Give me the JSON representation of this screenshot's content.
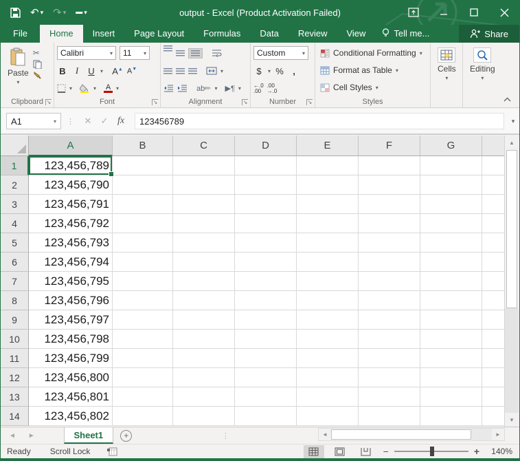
{
  "window": {
    "title": "output - Excel (Product Activation Failed)"
  },
  "tabs": {
    "file": "File",
    "items": [
      "Home",
      "Insert",
      "Page Layout",
      "Formulas",
      "Data",
      "Review",
      "View"
    ],
    "active": "Home",
    "tell_me": "Tell me...",
    "share": "Share"
  },
  "ribbon": {
    "clipboard": {
      "label": "Clipboard",
      "paste": "Paste"
    },
    "font": {
      "label": "Font",
      "name": "Calibri",
      "size": "11",
      "bold": "B",
      "italic": "I",
      "underline": "U",
      "grow": "A",
      "shrink": "A",
      "color_a": "A"
    },
    "alignment": {
      "label": "Alignment",
      "orient": "ab",
      "para": "¶"
    },
    "number": {
      "label": "Number",
      "format": "Custom",
      "currency": "$",
      "percent": "%",
      "comma": ",",
      "inc_top": "←.0",
      "inc_bot": ".00",
      "dec_top": ".00",
      "dec_bot": "→.0"
    },
    "styles": {
      "label": "Styles",
      "items": [
        "Conditional Formatting",
        "Format as Table",
        "Cell Styles"
      ]
    },
    "cells": {
      "label": "Cells"
    },
    "editing": {
      "label": "Editing"
    }
  },
  "formula_bar": {
    "name_box": "A1",
    "fx": "fx",
    "value": "123456789"
  },
  "grid": {
    "columns": [
      "A",
      "B",
      "C",
      "D",
      "E",
      "F",
      "G"
    ],
    "selected_column": "A",
    "selected_row": "1",
    "rows": [
      {
        "n": "1",
        "a": "123,456,789"
      },
      {
        "n": "2",
        "a": "123,456,790"
      },
      {
        "n": "3",
        "a": "123,456,791"
      },
      {
        "n": "4",
        "a": "123,456,792"
      },
      {
        "n": "5",
        "a": "123,456,793"
      },
      {
        "n": "6",
        "a": "123,456,794"
      },
      {
        "n": "7",
        "a": "123,456,795"
      },
      {
        "n": "8",
        "a": "123,456,796"
      },
      {
        "n": "9",
        "a": "123,456,797"
      },
      {
        "n": "10",
        "a": "123,456,798"
      },
      {
        "n": "11",
        "a": "123,456,799"
      },
      {
        "n": "12",
        "a": "123,456,800"
      },
      {
        "n": "13",
        "a": "123,456,801"
      },
      {
        "n": "14",
        "a": "123,456,802"
      }
    ]
  },
  "sheets": {
    "active": "Sheet1"
  },
  "status": {
    "mode": "Ready",
    "scroll_lock": "Scroll Lock",
    "zoom_out": "−",
    "zoom_in": "+",
    "zoom_level": "140%"
  },
  "colors": {
    "excel_green": "#217346",
    "fill_yellow": "#ffe600",
    "font_red": "#c00000"
  }
}
